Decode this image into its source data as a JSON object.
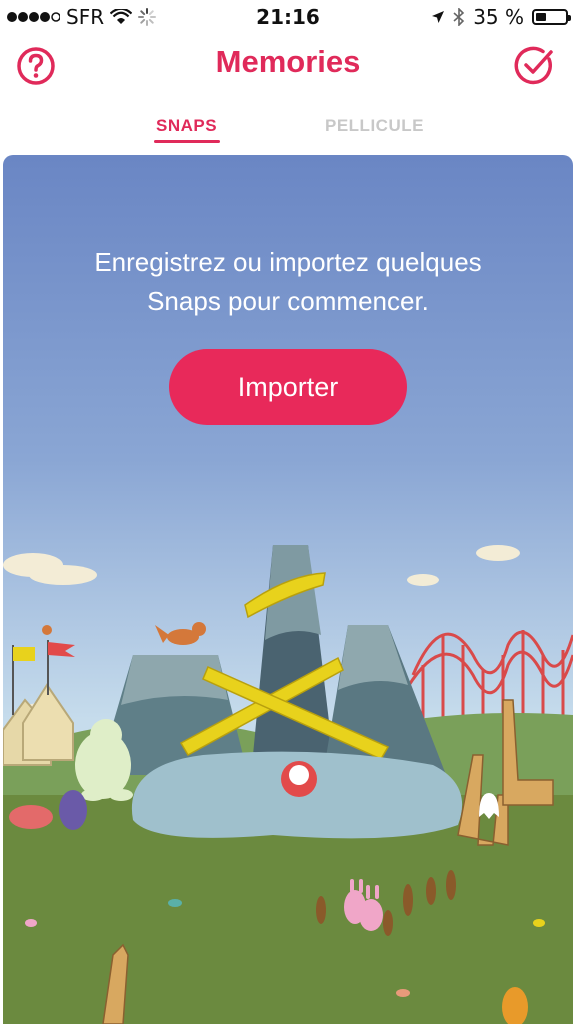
{
  "status_bar": {
    "carrier": "SFR",
    "time": "21:16",
    "battery_text": "35 %",
    "battery_level": 0.35,
    "icons": [
      "signal-dots-icon",
      "wifi-icon",
      "loading-spinner-icon",
      "location-arrow-icon",
      "bluetooth-icon",
      "battery-icon"
    ]
  },
  "header": {
    "title": "Memories",
    "help_icon": "question-circle-icon",
    "select_icon": "check-circle-icon"
  },
  "tabs": [
    {
      "label": "SNAPS",
      "active": true
    },
    {
      "label": "PELLICULE",
      "active": false
    }
  ],
  "empty_state": {
    "message_line1": "Enregistrez ou importez quelques",
    "message_line2": "Snaps pour commencer.",
    "import_button": "Importer"
  },
  "colors": {
    "accent": "#e02a5a",
    "button": "#e8295a",
    "sky_top": "#6a86c4",
    "grass": "#6b8a3f"
  }
}
